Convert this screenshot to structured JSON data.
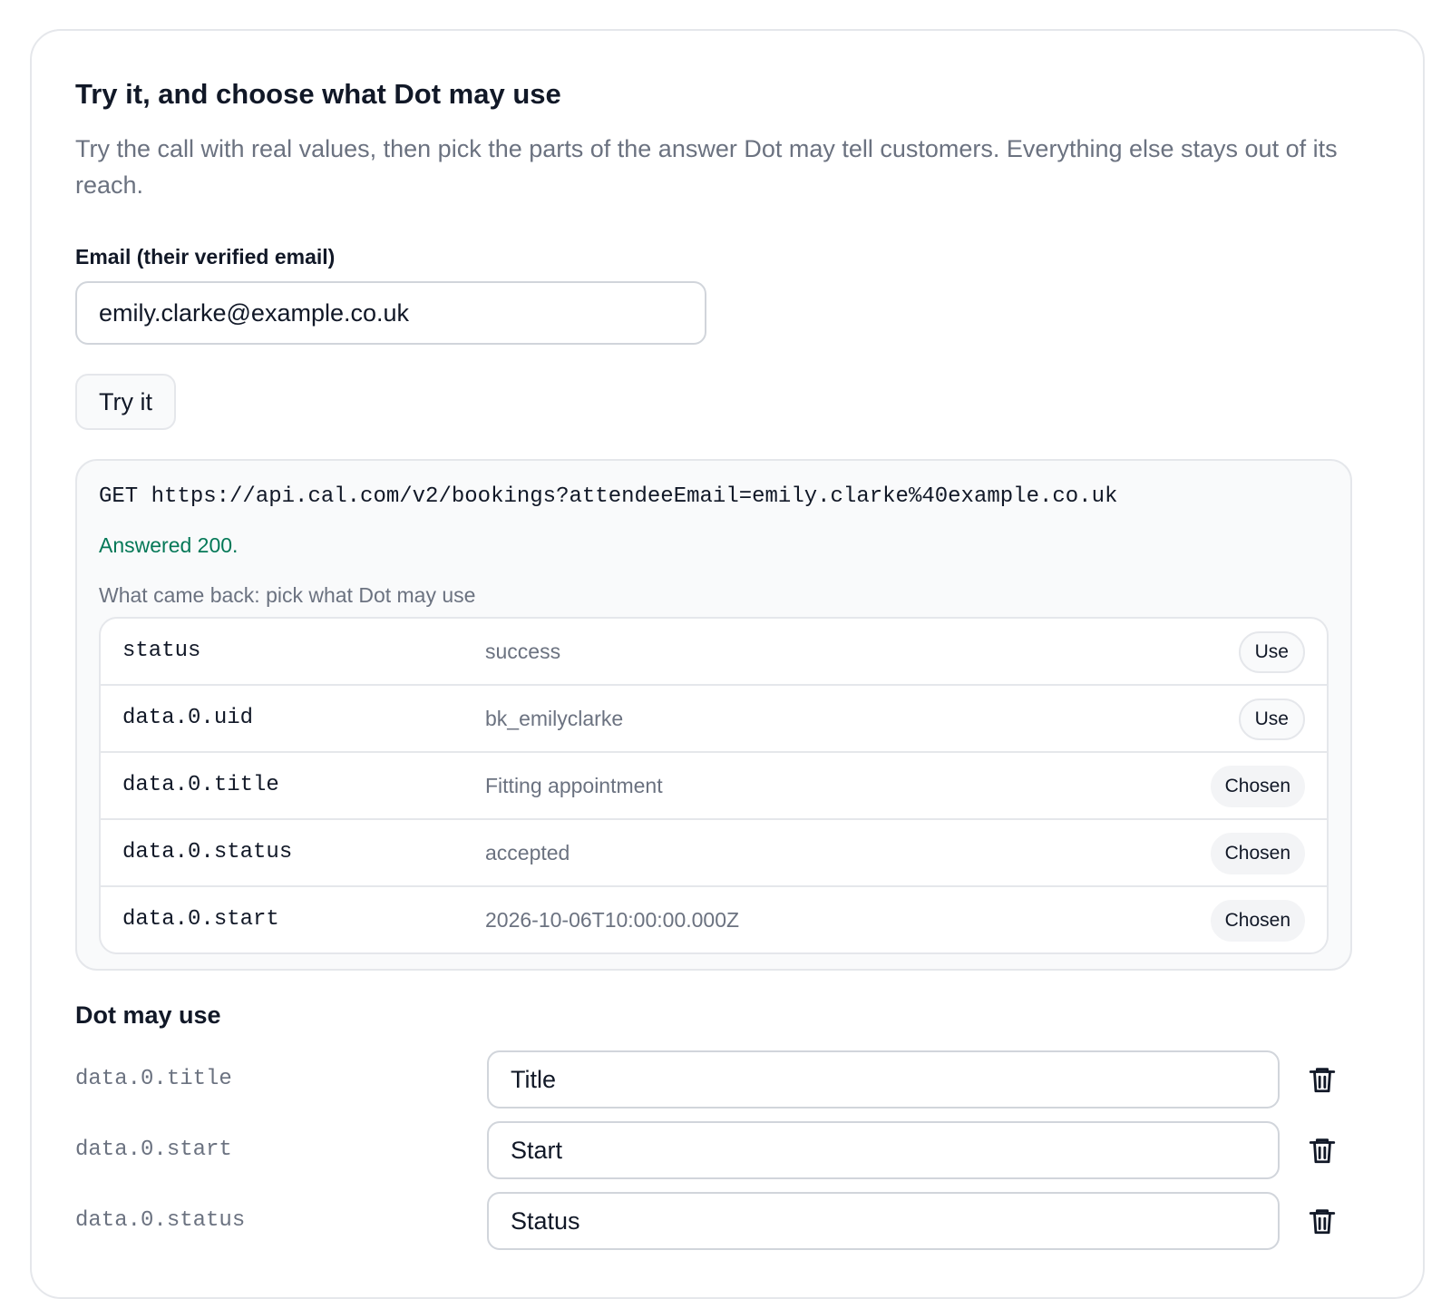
{
  "section": {
    "title": "Try it, and choose what Dot may use",
    "description": "Try the call with real values, then pick the parts of the answer Dot may tell customers. Everything else stays out of its reach."
  },
  "email_field": {
    "label": "Email (their verified email)",
    "value": "emily.clarke@example.co.uk"
  },
  "try_button": {
    "label": "Try it"
  },
  "result": {
    "request_line": "GET https://api.cal.com/v2/bookings?attendeeEmail=emily.clarke%40example.co.uk",
    "status_text": "Answered 200.",
    "fields_heading": "What came back: pick what Dot may use",
    "fields": [
      {
        "path": "status",
        "value": "success",
        "action": "Use",
        "chosen": false
      },
      {
        "path": "data.0.uid",
        "value": "bk_emilyclarke",
        "action": "Use",
        "chosen": false
      },
      {
        "path": "data.0.title",
        "value": "Fitting appointment",
        "action": "Chosen",
        "chosen": true
      },
      {
        "path": "data.0.status",
        "value": "accepted",
        "action": "Chosen",
        "chosen": true
      },
      {
        "path": "data.0.start",
        "value": "2026-10-06T10:00:00.000Z",
        "action": "Chosen",
        "chosen": true
      }
    ]
  },
  "may_use": {
    "title": "Dot may use",
    "items": [
      {
        "path": "data.0.title",
        "label": "Title",
        "icon": "trash-icon"
      },
      {
        "path": "data.0.start",
        "label": "Start",
        "icon": "trash-icon"
      },
      {
        "path": "data.0.status",
        "label": "Status",
        "icon": "trash-icon"
      }
    ]
  },
  "colors": {
    "success": "#047857",
    "muted_text": "#6b7280",
    "border": "#e5e7eb"
  }
}
